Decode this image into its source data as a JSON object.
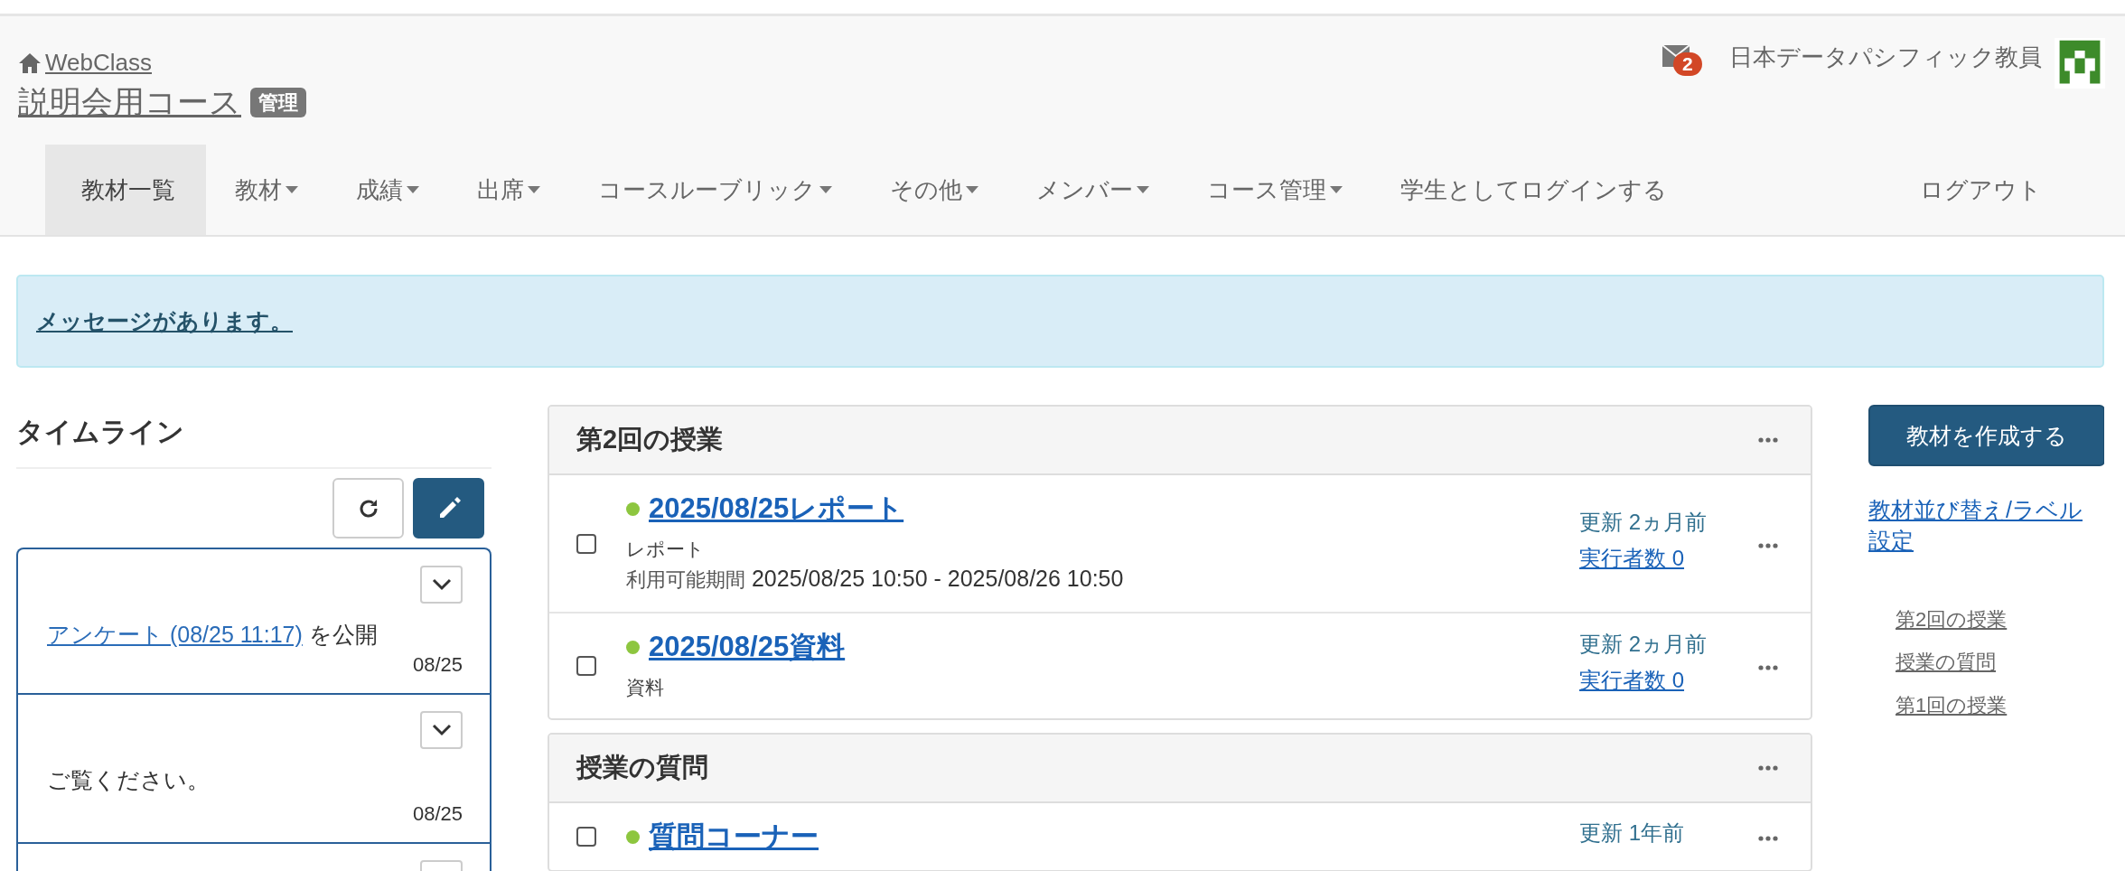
{
  "header": {
    "home_link": "WebClass",
    "course_title": "説明会用コース",
    "role_badge": "管理",
    "mail_count": "2",
    "user_name": "日本データパシフィック教員"
  },
  "nav": [
    {
      "label": "教材一覧",
      "selected": true,
      "dropdown": false
    },
    {
      "label": "教材",
      "selected": false,
      "dropdown": true
    },
    {
      "label": "成績",
      "selected": false,
      "dropdown": true
    },
    {
      "label": "出席",
      "selected": false,
      "dropdown": true
    },
    {
      "label": "コースルーブリック",
      "selected": false,
      "dropdown": true
    },
    {
      "label": "その他",
      "selected": false,
      "dropdown": true
    },
    {
      "label": "メンバー",
      "selected": false,
      "dropdown": true
    },
    {
      "label": "コース管理",
      "selected": false,
      "dropdown": true
    },
    {
      "label": "学生としてログインする",
      "selected": false,
      "dropdown": false
    },
    {
      "label": "ログアウト",
      "selected": false,
      "dropdown": false
    }
  ],
  "alert": {
    "link": "メッセージがあります。"
  },
  "timeline": {
    "title": "タイムライン",
    "items": [
      {
        "kind": "link",
        "link": "アンケート (08/25 11:17)",
        "text": "を公開",
        "date": "08/25"
      },
      {
        "kind": "text",
        "text": "ご覧ください。",
        "date": "08/25"
      },
      {
        "kind": "cut"
      }
    ]
  },
  "sections": [
    {
      "title": "第2回の授業",
      "items": [
        {
          "title": "2025/08/25レポート",
          "published": true,
          "checked": false,
          "type": "レポート",
          "period_label": "利用可能期間",
          "period": "2025/08/25 10:50 - 2025/08/26 10:50",
          "updated": "更新 2ヵ月前",
          "runners": "実行者数 0"
        },
        {
          "title": "2025/08/25資料",
          "published": true,
          "checked": false,
          "type": "資料",
          "updated": "更新 2ヵ月前",
          "runners": "実行者数 0"
        }
      ]
    },
    {
      "title": "授業の質問",
      "items": [
        {
          "title": "質問コーナー",
          "published": true,
          "checked": false,
          "updated": "更新 1年前"
        }
      ]
    }
  ],
  "side": {
    "create_button": "教材を作成する",
    "reorder_link": "教材並び替え/ラベル設定",
    "section_links": [
      "第2回の授業",
      "授業の質問",
      "第1回の授業"
    ]
  }
}
